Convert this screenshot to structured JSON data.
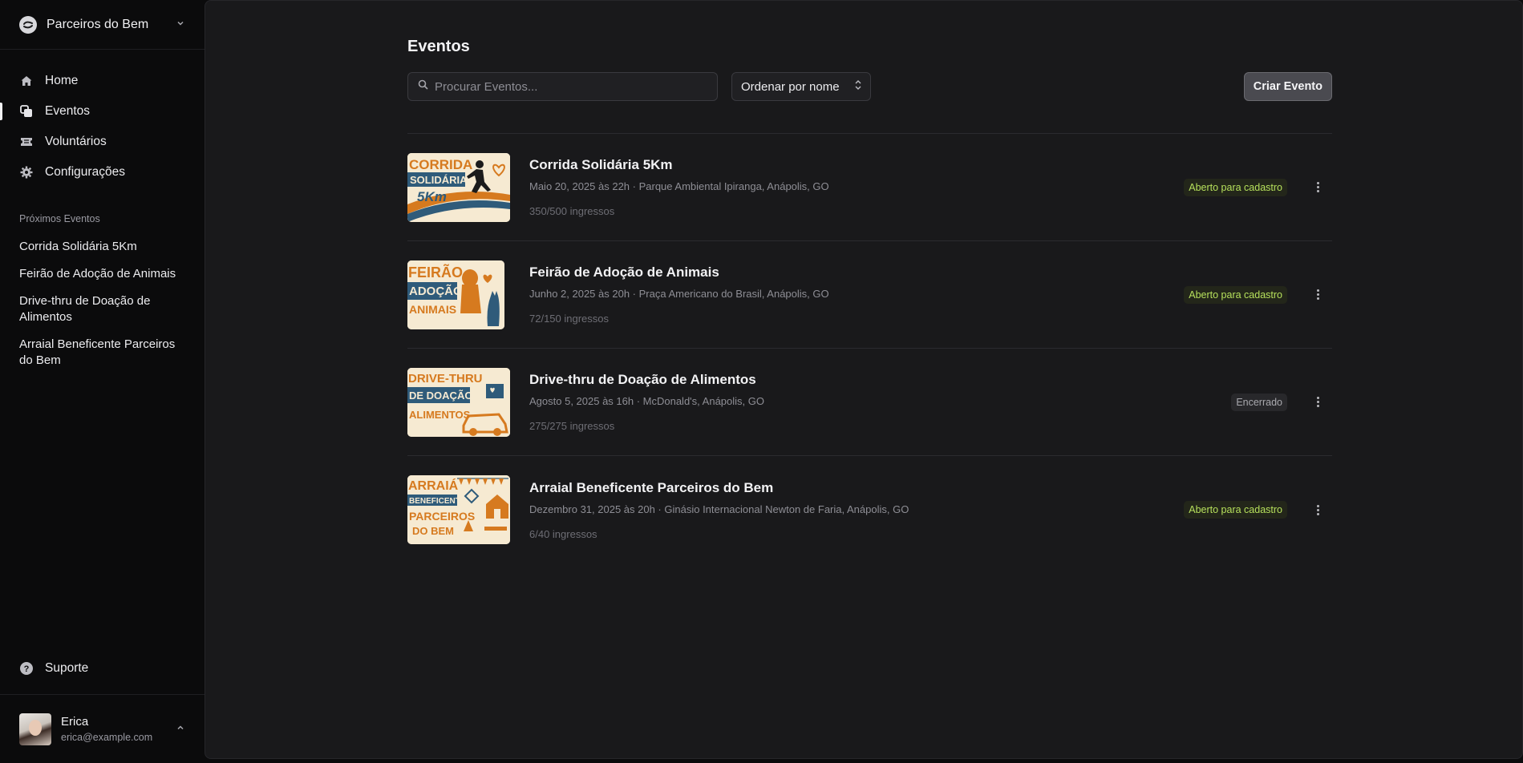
{
  "org": {
    "name": "Parceiros do Bem"
  },
  "nav": {
    "items": [
      {
        "label": "Home",
        "icon": "home-icon"
      },
      {
        "label": "Eventos",
        "icon": "events-icon",
        "active": true
      },
      {
        "label": "Voluntários",
        "icon": "ticket-icon"
      },
      {
        "label": "Configurações",
        "icon": "gear-icon"
      }
    ]
  },
  "upcoming": {
    "title": "Próximos Eventos",
    "items": [
      "Corrida Solidária 5Km",
      "Feirão de Adoção de Animais",
      "Drive-thru de Doação de Alimentos",
      "Arraial Beneficente Parceiros do Bem"
    ]
  },
  "support": {
    "label": "Suporte"
  },
  "user": {
    "name": "Erica",
    "email": "erica@example.com"
  },
  "page": {
    "title": "Eventos",
    "search_placeholder": "Procurar Eventos...",
    "sort_label": "Ordenar por nome",
    "create_label": "Criar Evento"
  },
  "events": [
    {
      "title": "Corrida Solidária 5Km",
      "meta": "Maio 20, 2025 às 22h · Parque Ambiental Ipiranga, Anápolis, GO",
      "tickets": "350/500 ingressos",
      "status": "Aberto para cadastro",
      "status_type": "open",
      "thumb_text": [
        "CORRIDA",
        "SOLIDÁRIA",
        "5Km"
      ]
    },
    {
      "title": "Feirão de Adoção de Animais",
      "meta": "Junho 2, 2025 às 20h · Praça Americano do Brasil, Anápolis, GO",
      "tickets": "72/150 ingressos",
      "status": "Aberto para cadastro",
      "status_type": "open",
      "thumb_text": [
        "FEIRÃO",
        "ADOÇÃO",
        "ANIMAIS"
      ]
    },
    {
      "title": "Drive-thru de Doação de Alimentos",
      "meta": "Agosto 5, 2025 às 16h · McDonald's, Anápolis, GO",
      "tickets": "275/275 ingressos",
      "status": "Encerrado",
      "status_type": "closed",
      "thumb_text": [
        "DRIVE-THRU",
        "DE DOAÇÃO",
        "ALIMENTOS"
      ]
    },
    {
      "title": "Arraial Beneficente Parceiros do Bem",
      "meta": "Dezembro 31, 2025 às 20h · Ginásio Internacional Newton de Faria, Anápolis, GO",
      "tickets": "6/40 ingressos",
      "status": "Aberto para cadastro",
      "status_type": "open",
      "thumb_text": [
        "ARRAIÁ",
        "BENEFICENTE",
        "PARCEIROS",
        "DO BEM"
      ]
    }
  ],
  "colors": {
    "open_status": "#b6e05c",
    "thumb_orange": "#d67a1f",
    "thumb_blue": "#2f5b7a",
    "thumb_bg": "#f6ead2"
  }
}
